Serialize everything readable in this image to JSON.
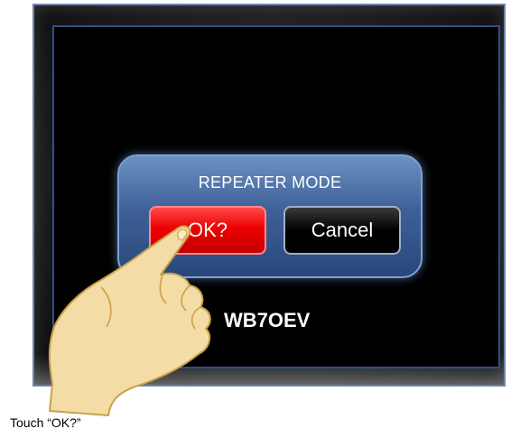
{
  "dialog": {
    "title": "REPEATER MODE",
    "ok_label": "OK?",
    "cancel_label": "Cancel"
  },
  "screen": {
    "callsign": "WB7OEV"
  },
  "caption": "Touch “OK?”",
  "colors": {
    "ok_button": "#ee0000",
    "cancel_button": "#000000",
    "dialog": "#3e6097",
    "screen": "#000000"
  },
  "icons": {
    "pointer": "pointing-hand-icon"
  }
}
